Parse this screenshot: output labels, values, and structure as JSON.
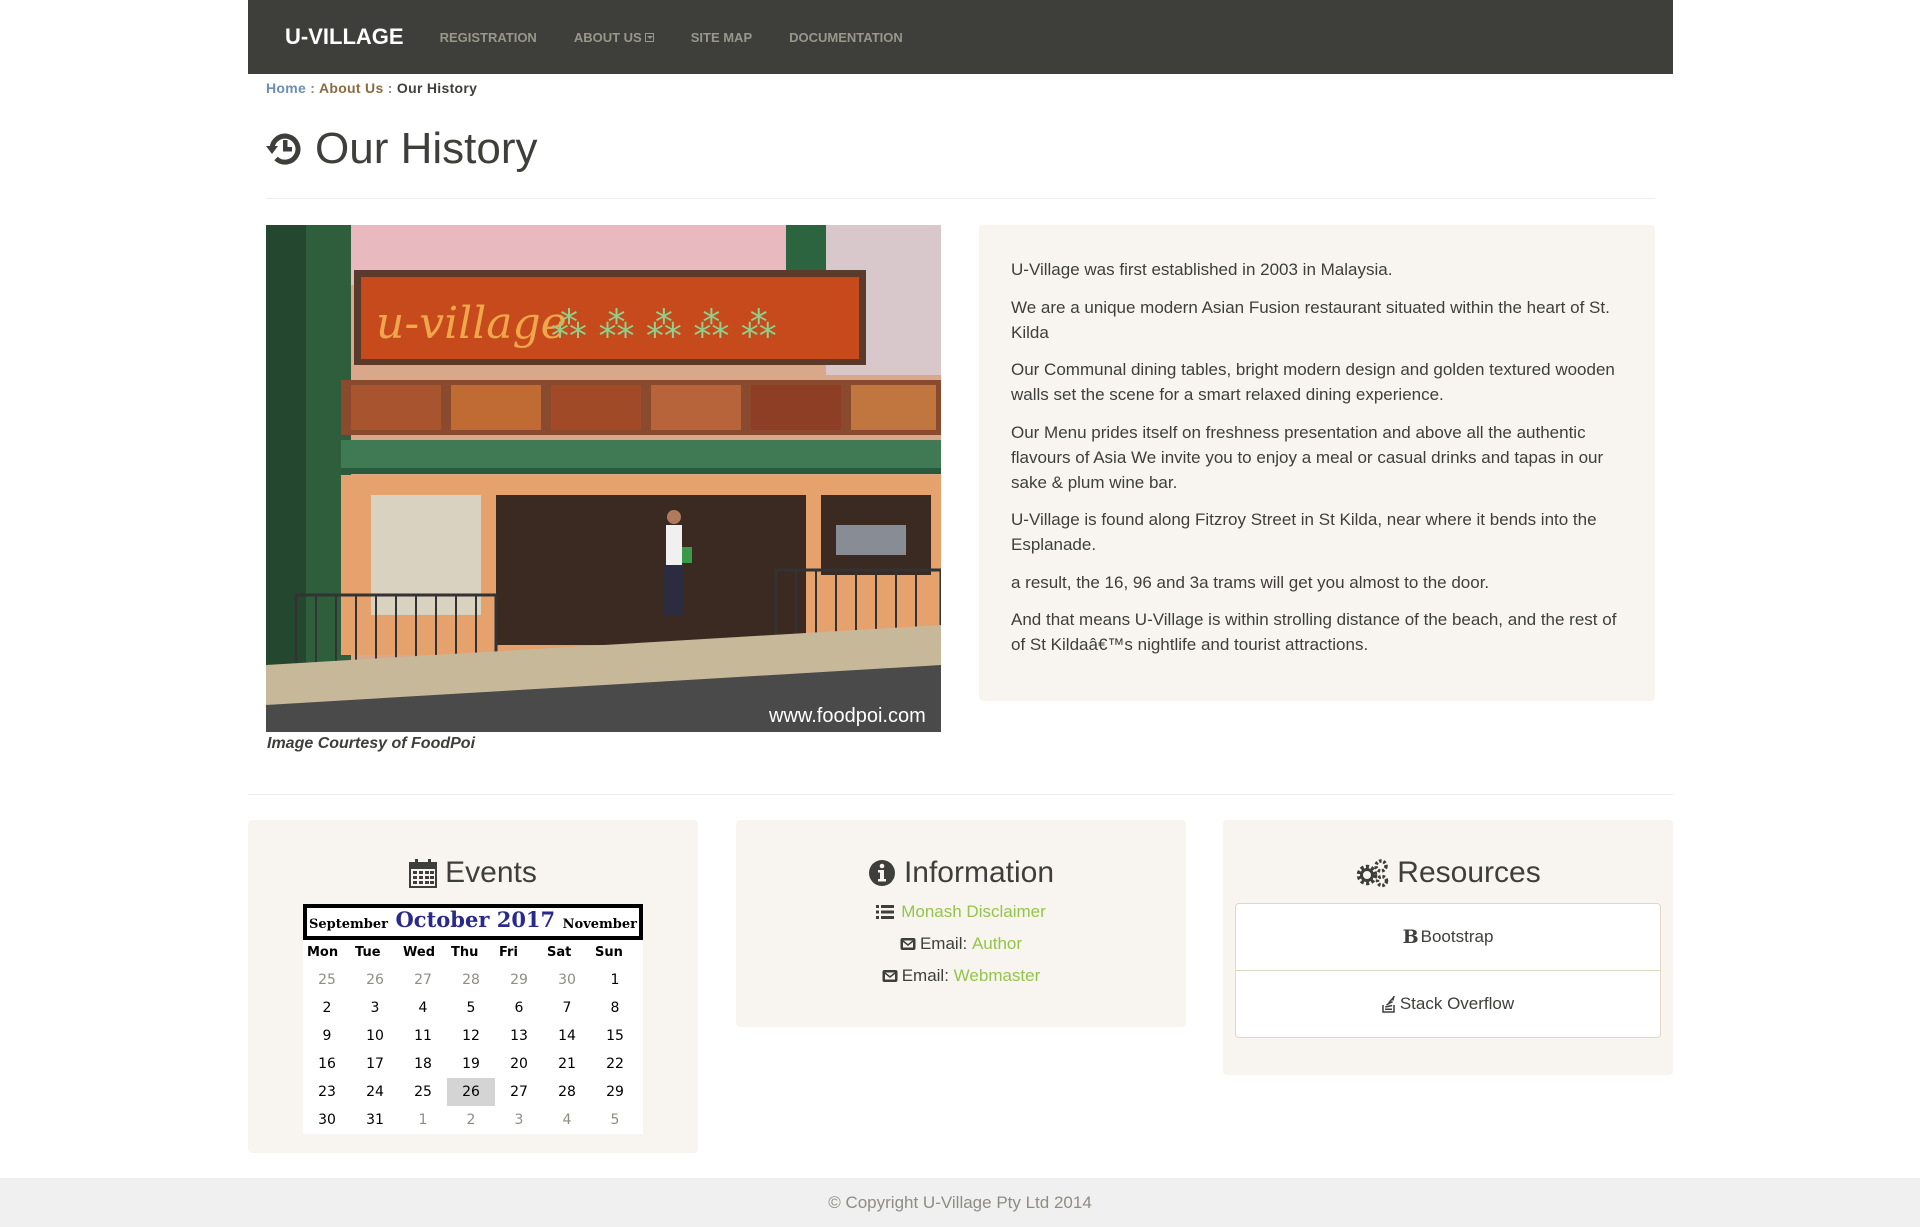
{
  "navbar": {
    "brand": "U-VILLAGE",
    "links": [
      "REGISTRATION",
      "ABOUT US",
      "SITE MAP",
      "DOCUMENTATION"
    ]
  },
  "breadcrumb": {
    "home": "Home",
    "sep": " : ",
    "about": "About Us",
    "current": "Our History"
  },
  "page": {
    "title": "Our History",
    "photo_watermark": "www.foodpoi.com",
    "photo_sign": "u-village",
    "photo_caption": "Image Courtesy of FoodPoi"
  },
  "history": {
    "paragraphs": [
      "U-Village was first established in 2003 in Malaysia.",
      "We are a unique modern Asian Fusion restaurant situated within the heart of St. Kilda",
      "Our Communal dining tables, bright modern design and golden textured wooden walls set the scene for a smart relaxed dining experience.",
      "Our Menu prides itself on freshness presentation and above all the authentic flavours of Asia We invite you to enjoy a meal or casual drinks and tapas in our sake & plum wine bar.",
      "U-Village is found along Fitzroy Street in St Kilda, near where it bends into the Esplanade.",
      "a result, the 16, 96 and 3a trams will get you almost to the door.",
      "And that means U-Village is within strolling distance of the beach, and the rest of of St Kildaâ€™s nightlife and tourist attractions."
    ]
  },
  "events": {
    "title": "Events",
    "calendar": {
      "prev": "September",
      "month": "October 2017",
      "next": "November",
      "days_of_week": [
        "Mon",
        "Tue",
        "Wed",
        "Thu",
        "Fri",
        "Sat",
        "Sun"
      ],
      "weeks": [
        [
          "25",
          "26",
          "27",
          "28",
          "29",
          "30",
          "1"
        ],
        [
          "2",
          "3",
          "4",
          "5",
          "6",
          "7",
          "8"
        ],
        [
          "9",
          "10",
          "11",
          "12",
          "13",
          "14",
          "15"
        ],
        [
          "16",
          "17",
          "18",
          "19",
          "20",
          "21",
          "22"
        ],
        [
          "23",
          "24",
          "25",
          "26",
          "27",
          "28",
          "29"
        ],
        [
          "30",
          "31",
          "1",
          "2",
          "3",
          "4",
          "5"
        ]
      ],
      "today": "26"
    }
  },
  "information": {
    "title": "Information",
    "disclaimer": "Monash Disclaimer",
    "email_label": "Email: ",
    "author": "Author",
    "webmaster": "Webmaster"
  },
  "resources": {
    "title": "Resources",
    "items": [
      "Bootstrap",
      "Stack Overflow"
    ]
  },
  "footer": {
    "copyright": "© Copyright U-Village Pty Ltd 2014"
  },
  "colors": {
    "navbar": "#3e3f3a",
    "well": "#f8f5f0",
    "link_green": "#93c54b",
    "calendar_month": "#2a2a8c"
  }
}
